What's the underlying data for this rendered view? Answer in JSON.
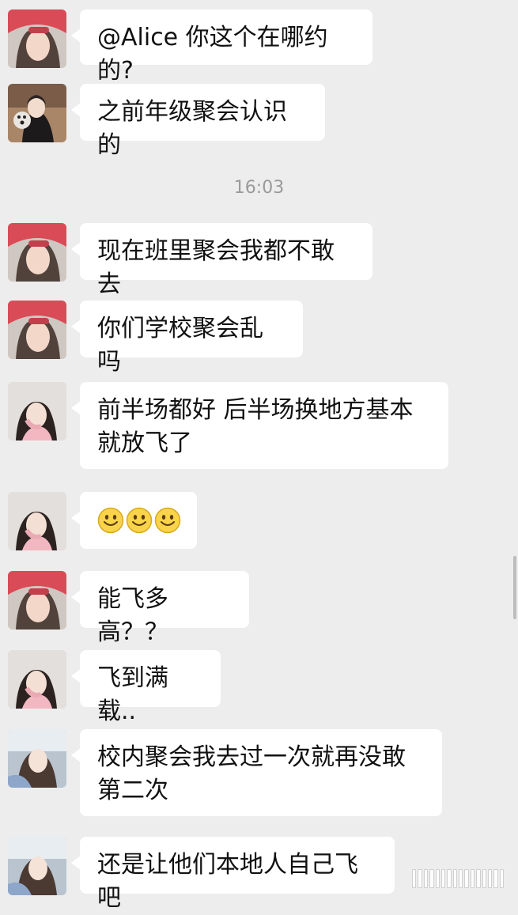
{
  "timestamp": "16:03",
  "messages": [
    {
      "avatar": "avatar-pink-beret",
      "text": "@Alice 你这个在哪约的?"
    },
    {
      "avatar": "avatar-girl-with-bear",
      "text": "之前年级聚会认识的"
    },
    {
      "avatar": "avatar-pink-beret",
      "text": "现在班里聚会我都不敢去"
    },
    {
      "avatar": "avatar-pink-beret",
      "text": "你们学校聚会乱吗"
    },
    {
      "avatar": "avatar-girl-pink-sweater",
      "text": "前半场都好 后半场换地方基本就放飞了"
    },
    {
      "avatar": "avatar-girl-pink-sweater",
      "text": "",
      "emojis": [
        "smile-emoji",
        "smile-emoji",
        "smile-emoji"
      ]
    },
    {
      "avatar": "avatar-pink-beret",
      "text": "能飞多高？？"
    },
    {
      "avatar": "avatar-girl-pink-sweater",
      "text": "飞到满载.."
    },
    {
      "avatar": "avatar-girl-in-car",
      "text": "校内聚会我去过一次就再没敢第二次"
    },
    {
      "avatar": "avatar-girl-in-car",
      "text": "还是让他们本地人自己飞吧"
    }
  ],
  "colors": {
    "background": "#ededed",
    "bubble": "#ffffff",
    "text": "#111111",
    "timestamp": "#9a9a9a"
  }
}
